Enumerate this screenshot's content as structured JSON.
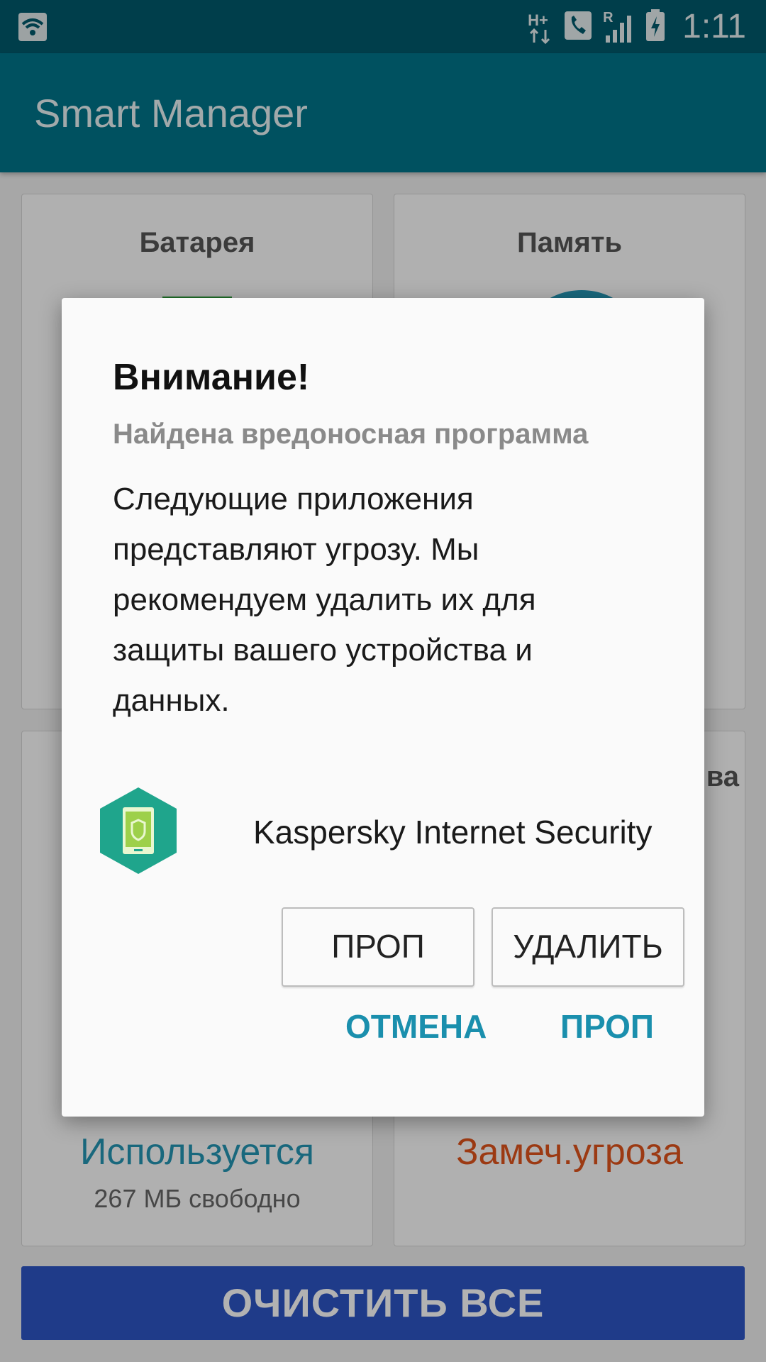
{
  "status_bar": {
    "time": "1:11",
    "network_label": "H+",
    "roaming_label": "R",
    "icons": [
      "wifi-icon",
      "data-arrows-icon",
      "call-icon",
      "signal-icon",
      "battery-charging-icon"
    ]
  },
  "app_bar": {
    "title": "Smart Manager"
  },
  "cards": {
    "battery": {
      "title": "Батарея"
    },
    "memory": {
      "title": "Память"
    },
    "storage": {
      "title_suffix": "ва",
      "status": "Используется",
      "sub": "267 МБ свободно"
    },
    "security": {
      "status": "Замеч.угроза"
    }
  },
  "clean_button": {
    "label": "ОЧИСТИТЬ ВСЕ"
  },
  "dialog": {
    "title": "Внимание!",
    "subtitle": "Найдена вредоносная программа",
    "body": "Следующие приложения представляют угрозу. Мы рекомендуем удалить их для защиты вашего устройства и данных.",
    "app": {
      "name": "Kaspersky Internet Security",
      "icon": "kaspersky-shield-icon"
    },
    "buttons": {
      "skip": "ПРОП",
      "delete": "УДАЛИТЬ"
    },
    "actions": {
      "cancel": "ОТМЕНА",
      "skip": "ПРОП"
    }
  },
  "colors": {
    "status_bar": "#005a6c",
    "app_bar": "#00748a",
    "accent": "#1a8fad",
    "storage_status": "#2596b4",
    "threat": "#e0531c",
    "clean_button": "#2d55c4"
  }
}
